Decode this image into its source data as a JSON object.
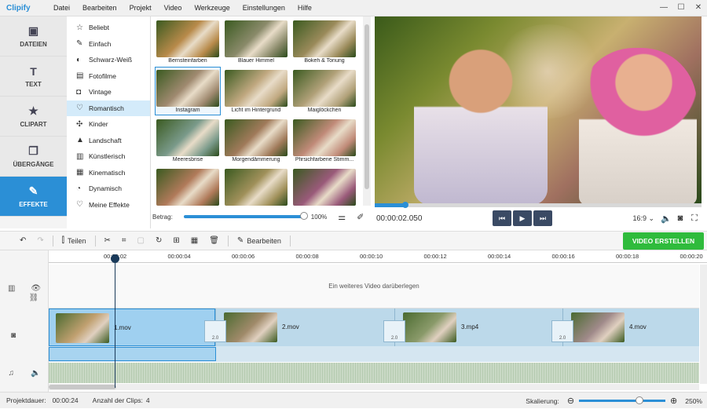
{
  "app": {
    "logo": "Clipify",
    "window_buttons": [
      "—",
      "☐",
      "✕"
    ]
  },
  "menu": [
    "Datei",
    "Bearbeiten",
    "Projekt",
    "Video",
    "Werkzeuge",
    "Einstellungen",
    "Hilfe"
  ],
  "left_tabs": [
    {
      "label": "DATEIEN",
      "icon": "image-icon",
      "glyph": "▣"
    },
    {
      "label": "TEXT",
      "icon": "text-icon",
      "glyph": "T"
    },
    {
      "label": "CLIPART",
      "icon": "star-icon",
      "glyph": "★"
    },
    {
      "label": "ÜBERGÄNGE",
      "icon": "transitions-icon",
      "glyph": "❐"
    },
    {
      "label": "EFFEKTE",
      "icon": "magic-wand-icon",
      "glyph": "✎",
      "active": true
    }
  ],
  "categories": [
    {
      "label": "Beliebt",
      "glyph": "☆",
      "icon": "star-outline-icon"
    },
    {
      "label": "Einfach",
      "glyph": "✎",
      "icon": "pencil-icon"
    },
    {
      "label": "Schwarz-Weiß",
      "glyph": "◐",
      "icon": "contrast-icon"
    },
    {
      "label": "Fotofilme",
      "glyph": "▤",
      "icon": "film-icon"
    },
    {
      "label": "Vintage",
      "glyph": "◘",
      "icon": "camera-icon"
    },
    {
      "label": "Romantisch",
      "glyph": "♡",
      "icon": "heart-icon",
      "active": true
    },
    {
      "label": "Kinder",
      "glyph": "✣",
      "icon": "kids-icon"
    },
    {
      "label": "Landschaft",
      "glyph": "▲",
      "icon": "mountain-icon"
    },
    {
      "label": "Künstlerisch",
      "glyph": "▥",
      "icon": "palette-icon"
    },
    {
      "label": "Kinematisch",
      "glyph": "▦",
      "icon": "clapper-icon"
    },
    {
      "label": "Dynamisch",
      "glyph": "◔",
      "icon": "dynamic-icon"
    },
    {
      "label": "Meine Effekte",
      "glyph": "♡",
      "icon": "heart-outline-icon"
    }
  ],
  "effects": [
    {
      "label": "Bernsteinfarben",
      "color": "#b88a4a"
    },
    {
      "label": "Blauer Himmel",
      "color": "#8a8a6a"
    },
    {
      "label": "Bokeh & Tonung",
      "color": "#9a8a5a"
    },
    {
      "label": "Instagram",
      "color": "#a08a70",
      "selected": true
    },
    {
      "label": "Licht im Hintergrund",
      "color": "#c0a880"
    },
    {
      "label": "Maiglöckchen",
      "color": "#b0a078"
    },
    {
      "label": "Meeresbrise",
      "color": "#7a9a8a"
    },
    {
      "label": "Morgendämmerung",
      "color": "#a07a5a"
    },
    {
      "label": "Pfirsichfarbene Stimm...",
      "color": "#c08a78"
    },
    {
      "label": "",
      "color": "#b07a5a"
    },
    {
      "label": "",
      "color": "#a0905a"
    },
    {
      "label": "",
      "color": "#9a5a7a"
    }
  ],
  "strength": {
    "label": "Betrag:",
    "value": "100%",
    "fraction": 1.0
  },
  "player": {
    "time": "00:00:02.050",
    "aspect": "16:9 ⌄",
    "progress": 0.09
  },
  "toolbar": {
    "split": "Teilen",
    "edit": "Bearbeiten",
    "export": "VIDEO ERSTELLEN"
  },
  "ruler": [
    "00:00:02",
    "00:00:04",
    "00:00:06",
    "00:00:08",
    "00:00:10",
    "00:00:12",
    "00:00:14",
    "00:00:16",
    "00:00:18",
    "00:00:20"
  ],
  "overlay_hint": "Ein weiteres Video darüberlegen",
  "clips": [
    {
      "name": "1.mov",
      "color": "#c0a070"
    },
    {
      "name": "2.mov",
      "color": "#a08a6a"
    },
    {
      "name": "3.mp4",
      "color": "#8a9a6a"
    },
    {
      "name": "4.mov",
      "color": "#a08a8a"
    }
  ],
  "transition_label": "2.0",
  "status": {
    "duration_label": "Projektdauer:",
    "duration": "00:00:24",
    "clips_label": "Anzahl der Clips:",
    "clips": "4",
    "scale_label": "Skalierung:",
    "scale": "250%"
  }
}
